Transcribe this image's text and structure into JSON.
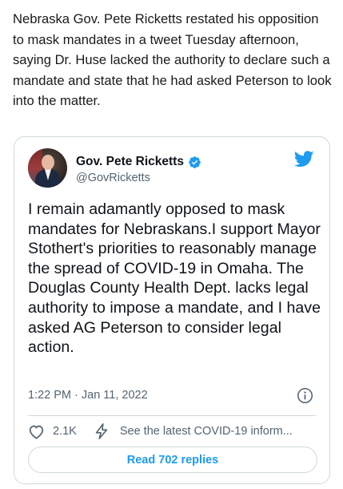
{
  "article": {
    "paragraph": "Nebraska Gov. Pete Ricketts restated his opposition to mask mandates in a tweet Tuesday afternoon, saying Dr. Huse lacked the authority to declare such a mandate and state that he had asked Peterson to look into the matter."
  },
  "tweet": {
    "author_name": "Gov. Pete Ricketts",
    "author_handle": "@GovRicketts",
    "text": "I remain adamantly opposed to mask mandates for Nebraskans.I support Mayor Stothert's priorities to reasonably manage the spread of COVID-19 in Omaha. The Douglas County Health Dept. lacks legal authority to impose a mandate, and I have asked AG Peterson to consider legal action.",
    "timestamp": "1:22 PM · Jan 11, 2022",
    "like_count": "2.1K",
    "latest_link": "See the latest COVID-19 inform...",
    "read_replies_label": "Read 702 replies",
    "icons": {
      "verified": "verified-badge-icon",
      "brand": "twitter-bird-icon",
      "info": "info-icon",
      "like": "heart-icon",
      "latest": "lightning-bolt-icon"
    },
    "colors": {
      "accent": "#1d9bf0",
      "muted": "#536471",
      "border": "#cfd9de"
    }
  }
}
